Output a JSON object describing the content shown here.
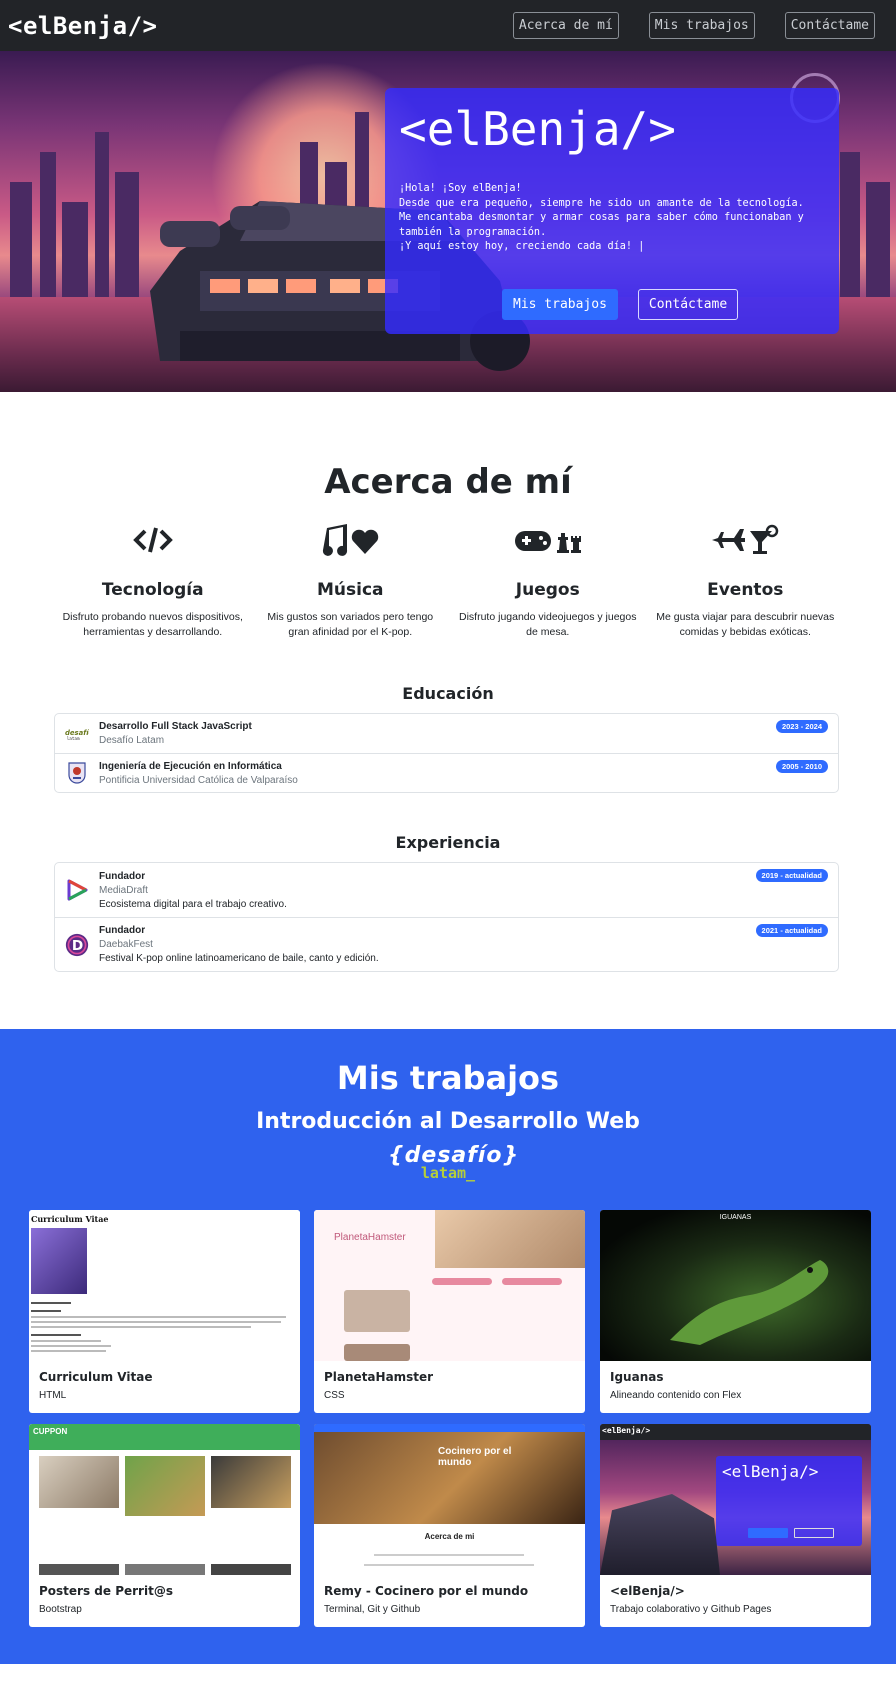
{
  "nav": {
    "brand": "<elBenja/>",
    "links": [
      "Acerca de mí",
      "Mis trabajos",
      "Contáctame"
    ]
  },
  "hero": {
    "title": "<elBenja/>",
    "lines": [
      "¡Hola! ¡Soy elBenja!",
      "Desde que era pequeño, siempre he sido un amante de la tecnología.",
      "Me encantaba desmontar y armar cosas para saber cómo funcionaban y también la programación.",
      "¡Y aquí estoy hoy, creciendo cada día! |"
    ],
    "btn_primary": "Mis trabajos",
    "btn_secondary": "Contáctame"
  },
  "about": {
    "title": "Acerca de mí",
    "features": [
      {
        "icon": "code-icon",
        "title": "Tecnología",
        "desc": "Disfruto probando nuevos dispositivos, herramientas y desarrollando."
      },
      {
        "icon": "music-heart-icon",
        "title": "Música",
        "desc": "Mis gustos son variados pero tengo gran afinidad por el K-pop."
      },
      {
        "icon": "gamepad-chess-icon",
        "title": "Juegos",
        "desc": "Disfruto jugando videojuegos y juegos de mesa."
      },
      {
        "icon": "plane-cocktail-icon",
        "title": "Eventos",
        "desc": "Me gusta viajar para descubrir nuevas comidas y bebidas exóticas."
      }
    ]
  },
  "education": {
    "title": "Educación",
    "items": [
      {
        "title": "Desarrollo Full Stack JavaScript",
        "org": "Desafío Latam",
        "years": "2023 - 2024",
        "logo": "desafio-logo"
      },
      {
        "title": "Ingeniería de Ejecución en Informática",
        "org": "Pontificia Universidad Católica de Valparaíso",
        "years": "2005 - 2010",
        "logo": "pucv-logo"
      }
    ]
  },
  "experience": {
    "title": "Experiencia",
    "items": [
      {
        "title": "Fundador",
        "org": "MediaDraft",
        "desc": "Ecosistema digital para el trabajo creativo.",
        "years": "2019 - actualidad",
        "logo": "mediadraft-logo"
      },
      {
        "title": "Fundador",
        "org": "DaebakFest",
        "desc": "Festival K-pop online latinoamericano de baile, canto y edición.",
        "years": "2021 - actualidad",
        "logo": "daebakfest-logo"
      }
    ]
  },
  "works": {
    "title": "Mis trabajos",
    "subtitle": "Introducción al Desarrollo Web",
    "logo_top": "{desafío}",
    "logo_bottom": "latam_",
    "cards": [
      {
        "title": "Curriculum Vitae",
        "desc": "HTML",
        "thumb_text": "Curriculum Vitae"
      },
      {
        "title": "PlanetaHamster",
        "desc": "CSS",
        "thumb_text": "PlanetaHamster"
      },
      {
        "title": "Iguanas",
        "desc": "Alineando contenido con Flex",
        "thumb_text": "IGUANAS"
      },
      {
        "title": "Posters de Perrit@s",
        "desc": "Bootstrap",
        "thumb_text": "CUPPON"
      },
      {
        "title": "Remy - Cocinero por el mundo",
        "desc": "Terminal, Git y Github",
        "thumb_text": "Cocinero por el mundo"
      },
      {
        "title": "<elBenja/>",
        "desc": "Trabajo colaborativo y Github Pages",
        "thumb_text": "<elBenja/>"
      }
    ]
  },
  "colors": {
    "nav_bg": "#222428",
    "hero_card": "#342cff",
    "accent": "#2f6bff",
    "works_bg": "#2f62ee"
  }
}
